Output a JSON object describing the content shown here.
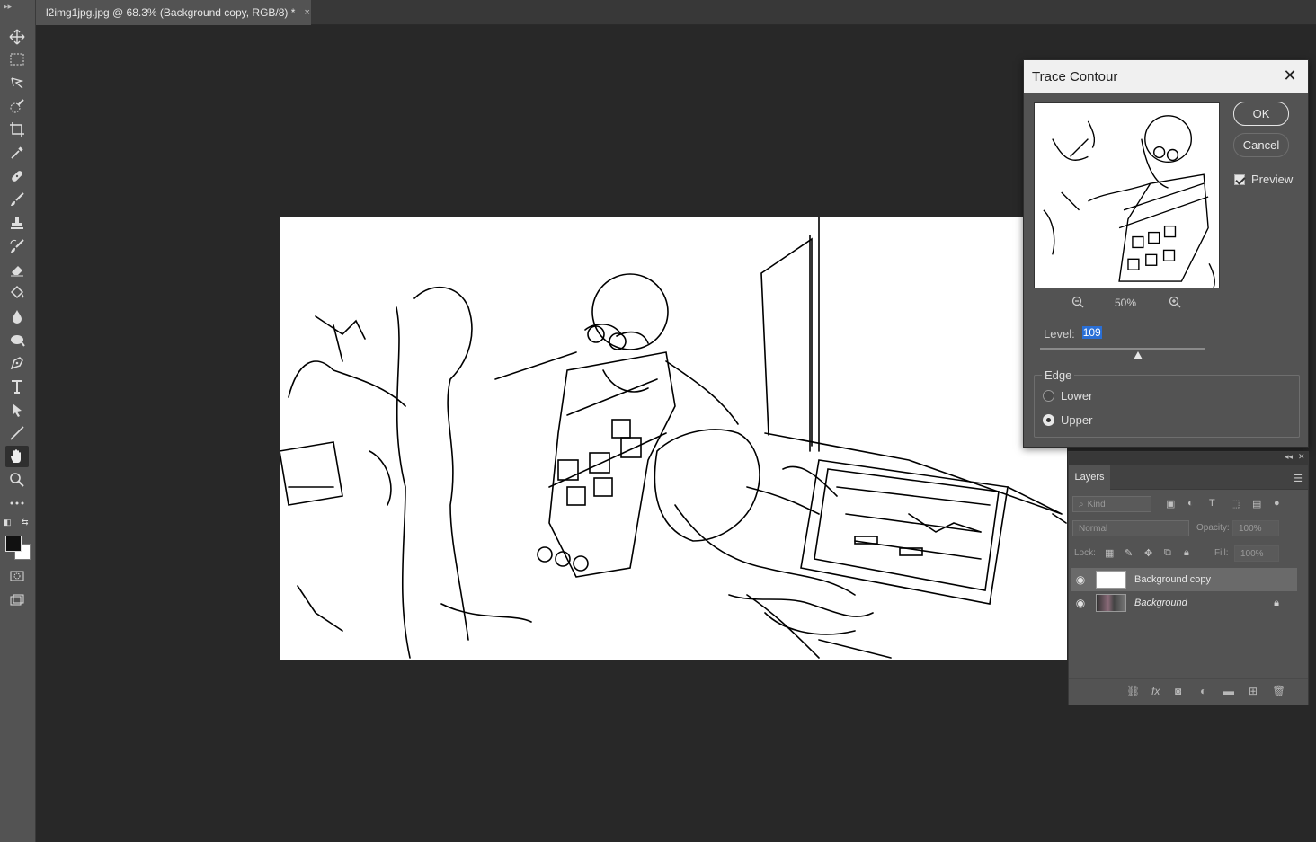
{
  "document_tab": {
    "title": "l2img1jpg.jpg @ 68.3% (Background copy, RGB/8) *",
    "close": "×"
  },
  "toolbar": {
    "tools": [
      {
        "name": "move-tool",
        "icon": "move-icon"
      },
      {
        "name": "marquee-tool",
        "icon": "rect-marquee-icon"
      },
      {
        "name": "lasso-tool",
        "icon": "lasso-icon"
      },
      {
        "name": "quick-selection-tool",
        "icon": "quick-select-icon"
      },
      {
        "name": "crop-tool",
        "icon": "crop-icon"
      },
      {
        "name": "eyedropper-tool",
        "icon": "eyedropper-icon"
      },
      {
        "name": "healing-brush-tool",
        "icon": "bandage-icon"
      },
      {
        "name": "brush-tool",
        "icon": "brush-icon"
      },
      {
        "name": "clone-stamp-tool",
        "icon": "stamp-icon"
      },
      {
        "name": "history-brush-tool",
        "icon": "history-brush-icon"
      },
      {
        "name": "eraser-tool",
        "icon": "eraser-icon"
      },
      {
        "name": "paint-bucket-tool",
        "icon": "bucket-icon"
      },
      {
        "name": "blur-tool",
        "icon": "drop-icon"
      },
      {
        "name": "dodge-tool",
        "icon": "dodge-icon"
      },
      {
        "name": "pen-tool",
        "icon": "pen-icon"
      },
      {
        "name": "type-tool",
        "icon": "type-icon",
        "glyph": "T"
      },
      {
        "name": "path-selection-tool",
        "icon": "arrow-icon"
      },
      {
        "name": "line-tool",
        "icon": "line-icon"
      },
      {
        "name": "hand-tool",
        "icon": "hand-icon",
        "active": true
      },
      {
        "name": "zoom-tool",
        "icon": "zoom-icon"
      },
      {
        "name": "more-tools",
        "icon": "ellipsis-icon",
        "glyph": "•••"
      }
    ],
    "foreground_color": "#111111",
    "background_color": "#ffffff"
  },
  "dialog": {
    "title": "Trace Contour",
    "ok_label": "OK",
    "cancel_label": "Cancel",
    "preview_label": "Preview",
    "preview_checked": true,
    "zoom_value": "50%",
    "level_label": "Level:",
    "level_value": "109",
    "edge_label": "Edge",
    "edge_options": [
      {
        "label": "Lower",
        "selected": false
      },
      {
        "label": "Upper",
        "selected": true
      }
    ]
  },
  "layers_panel": {
    "tab_label": "Layers",
    "kind_placeholder": "Kind",
    "blend_mode": "Normal",
    "opacity_label": "Opacity:",
    "opacity_value": "100%",
    "lock_label": "Lock:",
    "fill_label": "Fill:",
    "fill_value": "100%",
    "layers": [
      {
        "name": "Background copy",
        "visible": true,
        "selected": true,
        "locked": false
      },
      {
        "name": "Background",
        "visible": true,
        "selected": false,
        "locked": true
      }
    ]
  },
  "colors": {
    "workspace_bg": "#282828",
    "panel_bg": "#535353",
    "selection_highlight": "#2a6fd6"
  }
}
